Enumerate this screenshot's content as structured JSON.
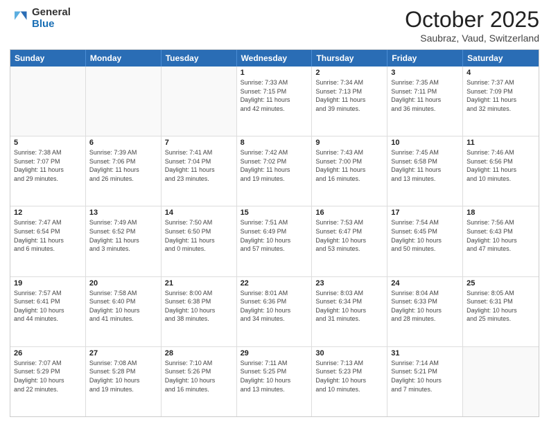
{
  "header": {
    "logo_line1": "General",
    "logo_line2": "Blue",
    "month": "October 2025",
    "location": "Saubraz, Vaud, Switzerland"
  },
  "weekdays": [
    "Sunday",
    "Monday",
    "Tuesday",
    "Wednesday",
    "Thursday",
    "Friday",
    "Saturday"
  ],
  "rows": [
    [
      {
        "day": "",
        "info": ""
      },
      {
        "day": "",
        "info": ""
      },
      {
        "day": "",
        "info": ""
      },
      {
        "day": "1",
        "info": "Sunrise: 7:33 AM\nSunset: 7:15 PM\nDaylight: 11 hours\nand 42 minutes."
      },
      {
        "day": "2",
        "info": "Sunrise: 7:34 AM\nSunset: 7:13 PM\nDaylight: 11 hours\nand 39 minutes."
      },
      {
        "day": "3",
        "info": "Sunrise: 7:35 AM\nSunset: 7:11 PM\nDaylight: 11 hours\nand 36 minutes."
      },
      {
        "day": "4",
        "info": "Sunrise: 7:37 AM\nSunset: 7:09 PM\nDaylight: 11 hours\nand 32 minutes."
      }
    ],
    [
      {
        "day": "5",
        "info": "Sunrise: 7:38 AM\nSunset: 7:07 PM\nDaylight: 11 hours\nand 29 minutes."
      },
      {
        "day": "6",
        "info": "Sunrise: 7:39 AM\nSunset: 7:06 PM\nDaylight: 11 hours\nand 26 minutes."
      },
      {
        "day": "7",
        "info": "Sunrise: 7:41 AM\nSunset: 7:04 PM\nDaylight: 11 hours\nand 23 minutes."
      },
      {
        "day": "8",
        "info": "Sunrise: 7:42 AM\nSunset: 7:02 PM\nDaylight: 11 hours\nand 19 minutes."
      },
      {
        "day": "9",
        "info": "Sunrise: 7:43 AM\nSunset: 7:00 PM\nDaylight: 11 hours\nand 16 minutes."
      },
      {
        "day": "10",
        "info": "Sunrise: 7:45 AM\nSunset: 6:58 PM\nDaylight: 11 hours\nand 13 minutes."
      },
      {
        "day": "11",
        "info": "Sunrise: 7:46 AM\nSunset: 6:56 PM\nDaylight: 11 hours\nand 10 minutes."
      }
    ],
    [
      {
        "day": "12",
        "info": "Sunrise: 7:47 AM\nSunset: 6:54 PM\nDaylight: 11 hours\nand 6 minutes."
      },
      {
        "day": "13",
        "info": "Sunrise: 7:49 AM\nSunset: 6:52 PM\nDaylight: 11 hours\nand 3 minutes."
      },
      {
        "day": "14",
        "info": "Sunrise: 7:50 AM\nSunset: 6:50 PM\nDaylight: 11 hours\nand 0 minutes."
      },
      {
        "day": "15",
        "info": "Sunrise: 7:51 AM\nSunset: 6:49 PM\nDaylight: 10 hours\nand 57 minutes."
      },
      {
        "day": "16",
        "info": "Sunrise: 7:53 AM\nSunset: 6:47 PM\nDaylight: 10 hours\nand 53 minutes."
      },
      {
        "day": "17",
        "info": "Sunrise: 7:54 AM\nSunset: 6:45 PM\nDaylight: 10 hours\nand 50 minutes."
      },
      {
        "day": "18",
        "info": "Sunrise: 7:56 AM\nSunset: 6:43 PM\nDaylight: 10 hours\nand 47 minutes."
      }
    ],
    [
      {
        "day": "19",
        "info": "Sunrise: 7:57 AM\nSunset: 6:41 PM\nDaylight: 10 hours\nand 44 minutes."
      },
      {
        "day": "20",
        "info": "Sunrise: 7:58 AM\nSunset: 6:40 PM\nDaylight: 10 hours\nand 41 minutes."
      },
      {
        "day": "21",
        "info": "Sunrise: 8:00 AM\nSunset: 6:38 PM\nDaylight: 10 hours\nand 38 minutes."
      },
      {
        "day": "22",
        "info": "Sunrise: 8:01 AM\nSunset: 6:36 PM\nDaylight: 10 hours\nand 34 minutes."
      },
      {
        "day": "23",
        "info": "Sunrise: 8:03 AM\nSunset: 6:34 PM\nDaylight: 10 hours\nand 31 minutes."
      },
      {
        "day": "24",
        "info": "Sunrise: 8:04 AM\nSunset: 6:33 PM\nDaylight: 10 hours\nand 28 minutes."
      },
      {
        "day": "25",
        "info": "Sunrise: 8:05 AM\nSunset: 6:31 PM\nDaylight: 10 hours\nand 25 minutes."
      }
    ],
    [
      {
        "day": "26",
        "info": "Sunrise: 7:07 AM\nSunset: 5:29 PM\nDaylight: 10 hours\nand 22 minutes."
      },
      {
        "day": "27",
        "info": "Sunrise: 7:08 AM\nSunset: 5:28 PM\nDaylight: 10 hours\nand 19 minutes."
      },
      {
        "day": "28",
        "info": "Sunrise: 7:10 AM\nSunset: 5:26 PM\nDaylight: 10 hours\nand 16 minutes."
      },
      {
        "day": "29",
        "info": "Sunrise: 7:11 AM\nSunset: 5:25 PM\nDaylight: 10 hours\nand 13 minutes."
      },
      {
        "day": "30",
        "info": "Sunrise: 7:13 AM\nSunset: 5:23 PM\nDaylight: 10 hours\nand 10 minutes."
      },
      {
        "day": "31",
        "info": "Sunrise: 7:14 AM\nSunset: 5:21 PM\nDaylight: 10 hours\nand 7 minutes."
      },
      {
        "day": "",
        "info": ""
      }
    ]
  ]
}
